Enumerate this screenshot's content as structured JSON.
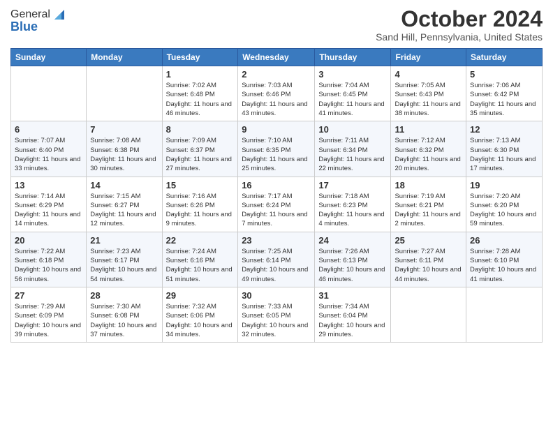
{
  "header": {
    "logo_general": "General",
    "logo_blue": "Blue",
    "title": "October 2024",
    "location": "Sand Hill, Pennsylvania, United States"
  },
  "days_of_week": [
    "Sunday",
    "Monday",
    "Tuesday",
    "Wednesday",
    "Thursday",
    "Friday",
    "Saturday"
  ],
  "weeks": [
    [
      {
        "day": "",
        "sunrise": "",
        "sunset": "",
        "daylight": ""
      },
      {
        "day": "",
        "sunrise": "",
        "sunset": "",
        "daylight": ""
      },
      {
        "day": "1",
        "sunrise": "Sunrise: 7:02 AM",
        "sunset": "Sunset: 6:48 PM",
        "daylight": "Daylight: 11 hours and 46 minutes."
      },
      {
        "day": "2",
        "sunrise": "Sunrise: 7:03 AM",
        "sunset": "Sunset: 6:46 PM",
        "daylight": "Daylight: 11 hours and 43 minutes."
      },
      {
        "day": "3",
        "sunrise": "Sunrise: 7:04 AM",
        "sunset": "Sunset: 6:45 PM",
        "daylight": "Daylight: 11 hours and 41 minutes."
      },
      {
        "day": "4",
        "sunrise": "Sunrise: 7:05 AM",
        "sunset": "Sunset: 6:43 PM",
        "daylight": "Daylight: 11 hours and 38 minutes."
      },
      {
        "day": "5",
        "sunrise": "Sunrise: 7:06 AM",
        "sunset": "Sunset: 6:42 PM",
        "daylight": "Daylight: 11 hours and 35 minutes."
      }
    ],
    [
      {
        "day": "6",
        "sunrise": "Sunrise: 7:07 AM",
        "sunset": "Sunset: 6:40 PM",
        "daylight": "Daylight: 11 hours and 33 minutes."
      },
      {
        "day": "7",
        "sunrise": "Sunrise: 7:08 AM",
        "sunset": "Sunset: 6:38 PM",
        "daylight": "Daylight: 11 hours and 30 minutes."
      },
      {
        "day": "8",
        "sunrise": "Sunrise: 7:09 AM",
        "sunset": "Sunset: 6:37 PM",
        "daylight": "Daylight: 11 hours and 27 minutes."
      },
      {
        "day": "9",
        "sunrise": "Sunrise: 7:10 AM",
        "sunset": "Sunset: 6:35 PM",
        "daylight": "Daylight: 11 hours and 25 minutes."
      },
      {
        "day": "10",
        "sunrise": "Sunrise: 7:11 AM",
        "sunset": "Sunset: 6:34 PM",
        "daylight": "Daylight: 11 hours and 22 minutes."
      },
      {
        "day": "11",
        "sunrise": "Sunrise: 7:12 AM",
        "sunset": "Sunset: 6:32 PM",
        "daylight": "Daylight: 11 hours and 20 minutes."
      },
      {
        "day": "12",
        "sunrise": "Sunrise: 7:13 AM",
        "sunset": "Sunset: 6:30 PM",
        "daylight": "Daylight: 11 hours and 17 minutes."
      }
    ],
    [
      {
        "day": "13",
        "sunrise": "Sunrise: 7:14 AM",
        "sunset": "Sunset: 6:29 PM",
        "daylight": "Daylight: 11 hours and 14 minutes."
      },
      {
        "day": "14",
        "sunrise": "Sunrise: 7:15 AM",
        "sunset": "Sunset: 6:27 PM",
        "daylight": "Daylight: 11 hours and 12 minutes."
      },
      {
        "day": "15",
        "sunrise": "Sunrise: 7:16 AM",
        "sunset": "Sunset: 6:26 PM",
        "daylight": "Daylight: 11 hours and 9 minutes."
      },
      {
        "day": "16",
        "sunrise": "Sunrise: 7:17 AM",
        "sunset": "Sunset: 6:24 PM",
        "daylight": "Daylight: 11 hours and 7 minutes."
      },
      {
        "day": "17",
        "sunrise": "Sunrise: 7:18 AM",
        "sunset": "Sunset: 6:23 PM",
        "daylight": "Daylight: 11 hours and 4 minutes."
      },
      {
        "day": "18",
        "sunrise": "Sunrise: 7:19 AM",
        "sunset": "Sunset: 6:21 PM",
        "daylight": "Daylight: 11 hours and 2 minutes."
      },
      {
        "day": "19",
        "sunrise": "Sunrise: 7:20 AM",
        "sunset": "Sunset: 6:20 PM",
        "daylight": "Daylight: 10 hours and 59 minutes."
      }
    ],
    [
      {
        "day": "20",
        "sunrise": "Sunrise: 7:22 AM",
        "sunset": "Sunset: 6:18 PM",
        "daylight": "Daylight: 10 hours and 56 minutes."
      },
      {
        "day": "21",
        "sunrise": "Sunrise: 7:23 AM",
        "sunset": "Sunset: 6:17 PM",
        "daylight": "Daylight: 10 hours and 54 minutes."
      },
      {
        "day": "22",
        "sunrise": "Sunrise: 7:24 AM",
        "sunset": "Sunset: 6:16 PM",
        "daylight": "Daylight: 10 hours and 51 minutes."
      },
      {
        "day": "23",
        "sunrise": "Sunrise: 7:25 AM",
        "sunset": "Sunset: 6:14 PM",
        "daylight": "Daylight: 10 hours and 49 minutes."
      },
      {
        "day": "24",
        "sunrise": "Sunrise: 7:26 AM",
        "sunset": "Sunset: 6:13 PM",
        "daylight": "Daylight: 10 hours and 46 minutes."
      },
      {
        "day": "25",
        "sunrise": "Sunrise: 7:27 AM",
        "sunset": "Sunset: 6:11 PM",
        "daylight": "Daylight: 10 hours and 44 minutes."
      },
      {
        "day": "26",
        "sunrise": "Sunrise: 7:28 AM",
        "sunset": "Sunset: 6:10 PM",
        "daylight": "Daylight: 10 hours and 41 minutes."
      }
    ],
    [
      {
        "day": "27",
        "sunrise": "Sunrise: 7:29 AM",
        "sunset": "Sunset: 6:09 PM",
        "daylight": "Daylight: 10 hours and 39 minutes."
      },
      {
        "day": "28",
        "sunrise": "Sunrise: 7:30 AM",
        "sunset": "Sunset: 6:08 PM",
        "daylight": "Daylight: 10 hours and 37 minutes."
      },
      {
        "day": "29",
        "sunrise": "Sunrise: 7:32 AM",
        "sunset": "Sunset: 6:06 PM",
        "daylight": "Daylight: 10 hours and 34 minutes."
      },
      {
        "day": "30",
        "sunrise": "Sunrise: 7:33 AM",
        "sunset": "Sunset: 6:05 PM",
        "daylight": "Daylight: 10 hours and 32 minutes."
      },
      {
        "day": "31",
        "sunrise": "Sunrise: 7:34 AM",
        "sunset": "Sunset: 6:04 PM",
        "daylight": "Daylight: 10 hours and 29 minutes."
      },
      {
        "day": "",
        "sunrise": "",
        "sunset": "",
        "daylight": ""
      },
      {
        "day": "",
        "sunrise": "",
        "sunset": "",
        "daylight": ""
      }
    ]
  ]
}
